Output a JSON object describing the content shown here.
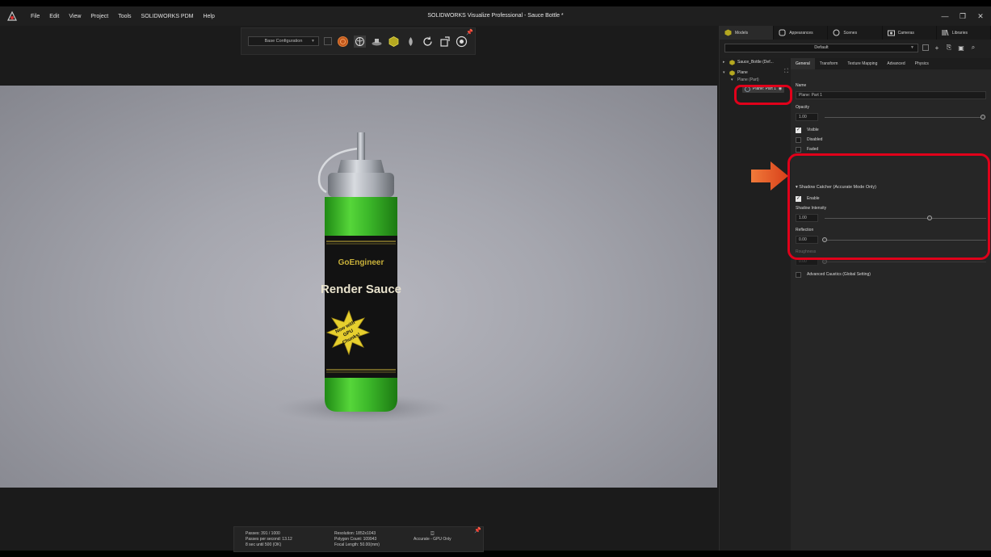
{
  "window": {
    "title": "SOLIDWORKS Visualize Professional - Sauce Bottle *"
  },
  "menu": [
    "File",
    "Edit",
    "View",
    "Project",
    "Tools",
    "SOLIDWORKS PDM",
    "Help"
  ],
  "toolbar": {
    "configuration": "Base Configuration"
  },
  "status": {
    "passes": "Passes: 391 / 1000",
    "passes_per_second": "Passes per second: 13.12",
    "eta": "8 sec until 500 (OK)",
    "resolution": "Resolution: 1852x1043",
    "polygon_count": "Polygon Count: 109943",
    "focal_length": "Focal Length: 50.00(mm)",
    "mode": "Accurate - GPU Only"
  },
  "panel": {
    "tabs": [
      "Models",
      "Appearances",
      "Scenes",
      "Cameras",
      "Libraries"
    ],
    "preset": "Default",
    "tree": {
      "root": "Sauce_Bottle (Def...",
      "group": "Plane",
      "child_hidden": "Plane (Part)",
      "selected": "Plane: Part 1"
    },
    "subtabs": [
      "General",
      "Transform",
      "Texture Mapping",
      "Advanced",
      "Physics"
    ],
    "general": {
      "name_label": "Name",
      "name_value": "Plane: Part 1",
      "opacity_label": "Opacity",
      "opacity_value": "1.00",
      "visible": "Visible",
      "disabled": "Disabled",
      "faded": "Faded"
    },
    "shadow": {
      "title": "Shadow Catcher (Accurate Mode Only)",
      "enable": "Enable",
      "intensity_label": "Shadow Intensity",
      "intensity_value": "1.00",
      "reflection_label": "Reflection",
      "reflection_value": "0.00",
      "roughness_label": "Roughness",
      "roughness_value": "0.00",
      "caustics": "Advanced Caustics (Global Setting)"
    }
  },
  "bottle": {
    "brand": "GoEngineer",
    "product": "Render Sauce",
    "starburst": [
      "Now with",
      "GPU",
      "Chunks!"
    ]
  },
  "colors": {
    "highlight": "#e0001a",
    "arrow": "#e8551c",
    "sauce": "#3fbf2a"
  },
  "slider_levels": {
    "opacity": 1.0,
    "shadow_intensity": 0.65,
    "reflection": 0.0,
    "roughness": 0.0
  }
}
